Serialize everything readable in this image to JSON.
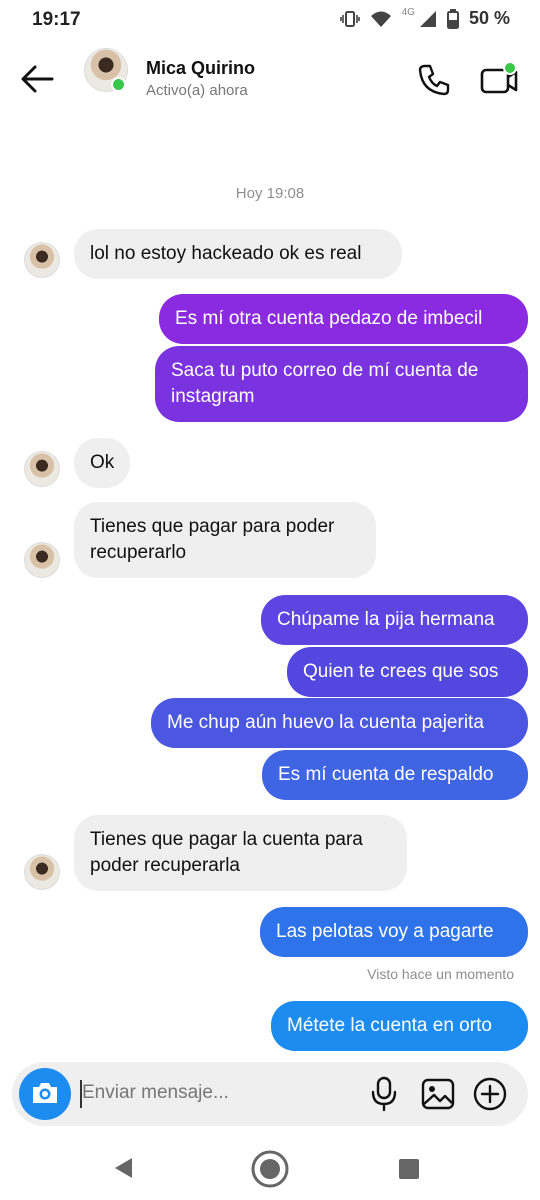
{
  "status_bar": {
    "time": "19:17",
    "network": "4G",
    "battery": "50 %"
  },
  "header": {
    "name": "Mica Quirino",
    "status": "Activo(a) ahora"
  },
  "chat": {
    "timestamp": "Hoy 19:08",
    "messages": [
      {
        "dir": "in",
        "text": "lol no estoy hackeado ok es real"
      },
      {
        "dir": "out",
        "text": "Es mí otra cuenta pedazo de imbecil"
      },
      {
        "dir": "out",
        "text": "Saca tu puto correo de mí cuenta de instagram"
      },
      {
        "dir": "in",
        "text": "Ok"
      },
      {
        "dir": "in",
        "text": "Tienes que pagar para poder recuperarlo"
      },
      {
        "dir": "out",
        "text": "Chúpame la pija hermana"
      },
      {
        "dir": "out",
        "text": "Quien te crees que sos"
      },
      {
        "dir": "out",
        "text": "Me chup aún huevo la cuenta pajerita"
      },
      {
        "dir": "out",
        "text": "Es mí cuenta de respaldo"
      },
      {
        "dir": "in",
        "text": "Tienes que pagar la cuenta para poder recuperarla"
      },
      {
        "dir": "out",
        "text": "Las pelotas voy a pagarte"
      },
      {
        "dir": "out",
        "text": "Métete la cuenta en orto"
      }
    ],
    "seen": "Visto hace un momento"
  },
  "composer": {
    "placeholder": "Enviar mensaje..."
  },
  "colors": {
    "accent": "#1d8cf0",
    "online": "#3bc84a",
    "incoming_bg": "#efefef",
    "outgoing_gradient": [
      "#8a2be2",
      "#6a3ee0",
      "#4b57e0",
      "#2f73ea",
      "#1d8cf0"
    ]
  },
  "icons": [
    "back-arrow-icon",
    "phone-icon",
    "video-icon",
    "camera-icon",
    "mic-icon",
    "gallery-icon",
    "plus-icon",
    "nav-back-icon",
    "nav-home-icon",
    "nav-recent-icon"
  ]
}
